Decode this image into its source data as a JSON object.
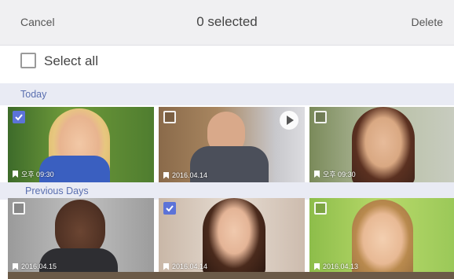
{
  "topbar": {
    "cancel": "Cancel",
    "count": "0 selected",
    "delete": "Delete"
  },
  "select_all": {
    "label": "Select all",
    "checked": false
  },
  "sections": [
    {
      "title": "Today",
      "tiles": [
        {
          "checked": true,
          "date": "오후 09:30",
          "is_video": false,
          "subject": "blonde child"
        },
        {
          "checked": false,
          "date": "2016.04.14",
          "is_video": true,
          "subject": "older man"
        },
        {
          "checked": false,
          "date": "오후 09:30",
          "is_video": false,
          "subject": "young woman"
        }
      ]
    },
    {
      "title": "Previous Days",
      "tiles": [
        {
          "checked": false,
          "date": "2016.04.15",
          "is_video": false,
          "subject": "young man"
        },
        {
          "checked": true,
          "date": "2016.04.14",
          "is_video": false,
          "subject": "woman smiling"
        },
        {
          "checked": false,
          "date": "2016.04.13",
          "is_video": false,
          "subject": "boy smiling"
        }
      ]
    }
  ],
  "colors": {
    "accent": "#5c73d8",
    "section_bg": "#e9ebf4",
    "topbar_bg": "#f0f0f2",
    "section_text": "#5a6fb0"
  },
  "icons": {
    "check": "check-icon",
    "play": "play-icon",
    "pin": "pin-icon"
  }
}
